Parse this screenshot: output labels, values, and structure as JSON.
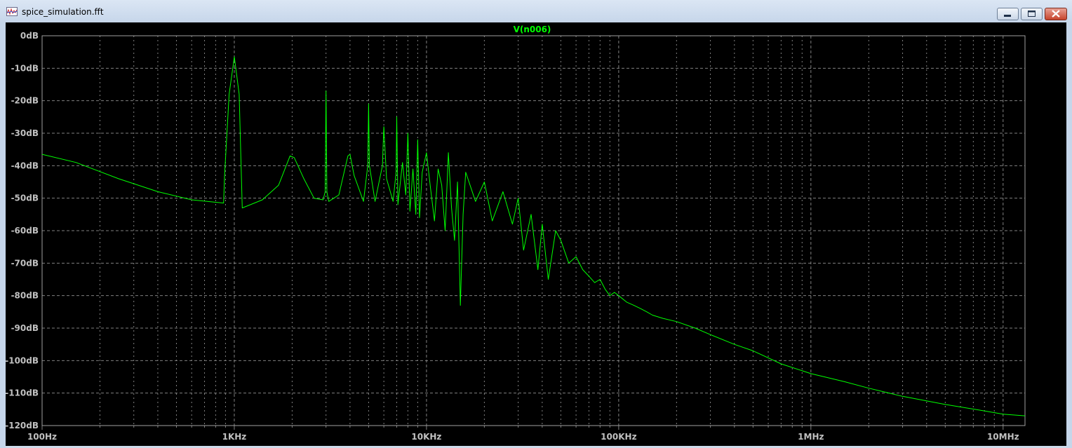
{
  "window": {
    "title": "spice_simulation.fft",
    "icon": "waveform-icon",
    "controls": [
      "minimize-icon",
      "maximize-icon",
      "close-icon"
    ]
  },
  "colors": {
    "background": "#000000",
    "trace": "#00ff00",
    "grid": "#808080",
    "labels": "#c0c0c0"
  },
  "chart_data": {
    "type": "line",
    "title": "V(n006)",
    "xlabel": "",
    "ylabel": "",
    "x_scale": "log",
    "xlim": [
      100,
      13000000
    ],
    "ylim": [
      -120,
      0
    ],
    "grid": true,
    "x_ticks": [
      {
        "value": 100,
        "label": "100Hz"
      },
      {
        "value": 1000,
        "label": "1KHz"
      },
      {
        "value": 10000,
        "label": "10KHz"
      },
      {
        "value": 100000,
        "label": "100KHz"
      },
      {
        "value": 1000000,
        "label": "1MHz"
      },
      {
        "value": 10000000,
        "label": "10MHz"
      }
    ],
    "y_ticks": [
      {
        "value": 0,
        "label": "0dB"
      },
      {
        "value": -10,
        "label": "-10dB"
      },
      {
        "value": -20,
        "label": "-20dB"
      },
      {
        "value": -30,
        "label": "-30dB"
      },
      {
        "value": -40,
        "label": "-40dB"
      },
      {
        "value": -50,
        "label": "-50dB"
      },
      {
        "value": -60,
        "label": "-60dB"
      },
      {
        "value": -70,
        "label": "-70dB"
      },
      {
        "value": -80,
        "label": "-80dB"
      },
      {
        "value": -90,
        "label": "-90dB"
      },
      {
        "value": -100,
        "label": "-100dB"
      },
      {
        "value": -110,
        "label": "-110dB"
      },
      {
        "value": -120,
        "label": "-120dB"
      }
    ],
    "series": [
      {
        "name": "V(n006)",
        "color": "#00ff00",
        "x": [
          100,
          150,
          250,
          400,
          600,
          880,
          890,
          940,
          1000,
          1060,
          1100,
          1400,
          1700,
          1950,
          2050,
          2300,
          2600,
          2900,
          2970,
          3000,
          3030,
          3100,
          3500,
          3900,
          4000,
          4200,
          4700,
          4950,
          5000,
          5050,
          5400,
          5900,
          6000,
          6200,
          6700,
          6950,
          7000,
          7100,
          7500,
          7800,
          8000,
          8200,
          8500,
          8800,
          9000,
          9200,
          9500,
          10000,
          10500,
          11000,
          11500,
          12000,
          12500,
          13000,
          13500,
          14000,
          14500,
          15000,
          15500,
          16000,
          18000,
          20000,
          22000,
          25000,
          28000,
          30000,
          32000,
          35000,
          38000,
          40000,
          43000,
          47000,
          50000,
          55000,
          60000,
          65000,
          70000,
          75000,
          80000,
          85000,
          90000,
          95000,
          100000,
          110000,
          120000,
          130000,
          140000,
          150000,
          170000,
          200000,
          250000,
          300000,
          400000,
          500000,
          700000,
          1000000,
          1500000,
          2000000,
          3000000,
          5000000,
          8000000,
          10000000,
          13000000
        ],
        "y": [
          -36.5,
          -39,
          -44,
          -48,
          -50.5,
          -51.5,
          -43,
          -18,
          -6.5,
          -18,
          -53,
          -50.5,
          -46,
          -37,
          -37.5,
          -44,
          -50,
          -50.5,
          -48,
          -17,
          -48,
          -51,
          -49,
          -37,
          -36.5,
          -43,
          -51,
          -40,
          -21,
          -40,
          -51,
          -40,
          -28,
          -44,
          -51,
          -42,
          -25,
          -52,
          -39,
          -49,
          -30,
          -54,
          -41,
          -55,
          -32,
          -56,
          -42,
          -36,
          -47,
          -57,
          -41,
          -46,
          -60,
          -36,
          -53,
          -63,
          -45,
          -83,
          -55,
          -42,
          -51,
          -45,
          -57,
          -48,
          -58,
          -50,
          -66,
          -55,
          -72,
          -58,
          -75,
          -60,
          -63,
          -70,
          -68,
          -72,
          -74,
          -76,
          -75,
          -78,
          -80,
          -79,
          -80,
          -82,
          -83,
          -84,
          -85,
          -86,
          -87,
          -88,
          -90,
          -92,
          -95,
          -97,
          -101,
          -104,
          -106.5,
          -108.5,
          -111,
          -113.5,
          -115.5,
          -116.5,
          -117
        ]
      }
    ]
  }
}
